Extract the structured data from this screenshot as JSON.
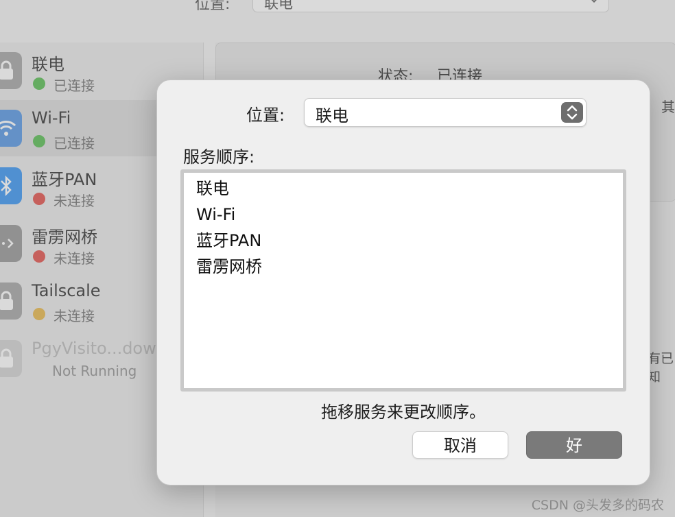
{
  "background": {
    "location_label": "位置:",
    "location_value": "联电",
    "status_label": "状态:",
    "status_value": "已连接",
    "partial_text_1": "其",
    "partial_text_2": "有已知",
    "services": [
      {
        "name": "联电",
        "status": "已连接",
        "dot_color": "#4cb946",
        "icon": "lock-icon",
        "icon_color": "#9e9e9e"
      },
      {
        "name": "Wi-Fi",
        "status": "已连接",
        "dot_color": "#4cb946",
        "icon": "wifi-icon",
        "icon_color": "#4a90e2"
      },
      {
        "name": "蓝牙PAN",
        "status": "未连接",
        "dot_color": "#e0443e",
        "icon": "bluetooth-icon",
        "icon_color": "#2c8ef2"
      },
      {
        "name": "雷雳网桥",
        "status": "未连接",
        "dot_color": "#e0443e",
        "icon": "thunderbolt-bridge-icon",
        "icon_color": "#8f8f8f"
      },
      {
        "name": "Tailscale",
        "status": "未连接",
        "dot_color": "#e6b23c",
        "icon": "lock-icon",
        "icon_color": "#9e9e9e"
      },
      {
        "name": "PgyVisito...dow",
        "status": "Not Running",
        "dot_color": "",
        "icon": "lock-icon",
        "icon_color": "#cfcfcf"
      }
    ]
  },
  "sheet": {
    "location_label": "位置:",
    "location_value": "联电",
    "service_order_label": "服务顺序:",
    "service_order": [
      "联电",
      "Wi-Fi",
      "蓝牙PAN",
      "雷雳网桥"
    ],
    "hint": "拖移服务来更改顺序。",
    "cancel_label": "取消",
    "ok_label": "好"
  },
  "watermark": "CSDN @头发多的码农"
}
